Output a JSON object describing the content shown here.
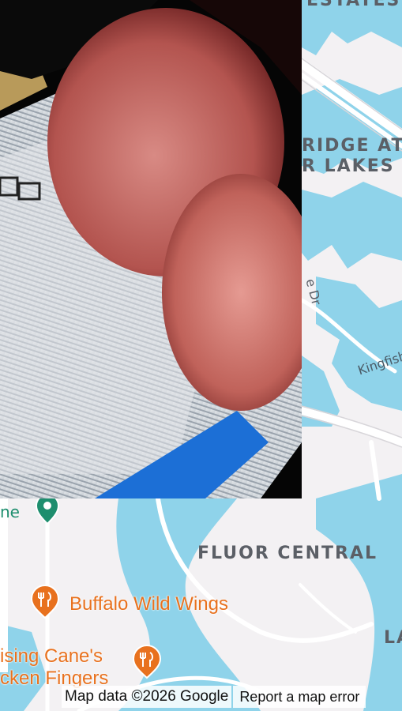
{
  "map": {
    "labels": {
      "top_cut": "ESTATES",
      "ridge_line1": "RIDGE AT",
      "ridge_line2": "R LAKES",
      "street_dr": "e Dr",
      "kingfish": "Kingfish",
      "fluor_central": "FLUOR CENTRAL",
      "edge_la": "LA",
      "edge_ne": "ne"
    },
    "pois": [
      {
        "name": "Buffalo Wild Wings",
        "icon": "restaurant-icon"
      },
      {
        "name_line1": "Raising Cane's",
        "name_line2": "Chicken Fingers",
        "visible_line1": "ising Cane's",
        "visible_line2": "cken Fingers",
        "icon": "restaurant-icon"
      }
    ],
    "colors": {
      "land": "#f3f1f3",
      "water": "#8fd3ea",
      "road": "#ffffff",
      "poi_orange": "#e8711e",
      "marker_green": "#1e8e6e"
    }
  },
  "footer": {
    "attribution": "Map data ©2026 Google",
    "report": "Report a map error"
  }
}
